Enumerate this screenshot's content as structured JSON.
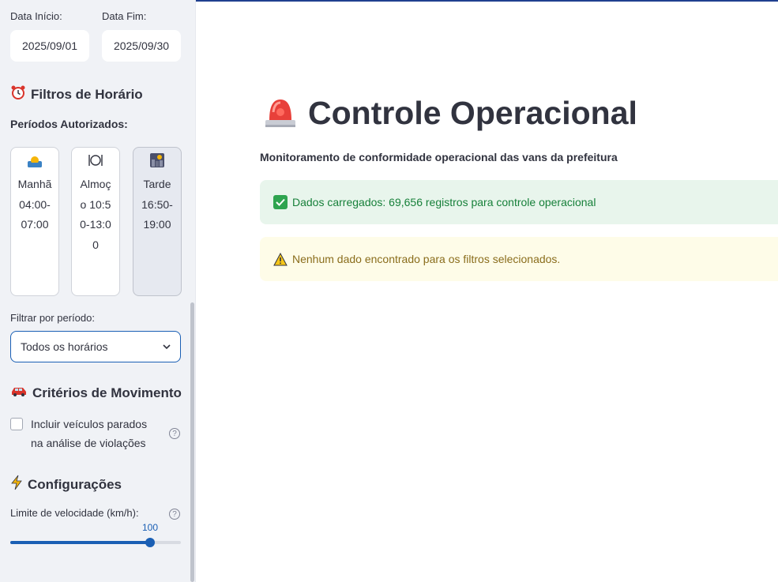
{
  "sidebar": {
    "date_start": {
      "label": "Data Início:",
      "value": "2025/09/01"
    },
    "date_end": {
      "label": "Data Fim:",
      "value": "2025/09/30"
    },
    "hours_section": {
      "title": "Filtros de Horário",
      "icon": "alarm-clock-icon"
    },
    "periods_heading": "Períodos Autorizados:",
    "periods": [
      {
        "icon": "sunrise-icon",
        "text": "Manhã 04:00-07:00",
        "active": false
      },
      {
        "icon": "plate-cutlery-icon",
        "text": "Almoço 10:50-13:00",
        "active": false
      },
      {
        "icon": "cityscape-dusk-icon",
        "text": "Tarde 16:50-19:00",
        "active": true
      }
    ],
    "filter": {
      "label": "Filtrar por período:",
      "selected": "Todos os horários"
    },
    "movement_section": {
      "title": "Critérios de Movimento",
      "icon": "car-icon"
    },
    "include_stopped": {
      "label": "Incluir veículos parados na análise de violações",
      "checked": false
    },
    "config_section": {
      "title": "Configurações",
      "icon": "lightning-icon"
    },
    "speed_limit": {
      "label": "Limite de velocidade (km/h):",
      "value": "100",
      "fraction": 0.82
    }
  },
  "main": {
    "title": "Controle Operacional",
    "title_icon": "siren-icon",
    "subtitle": "Monitoramento de conformidade operacional das vans da prefeitura",
    "success_message": "Dados carregados: 69,656 registros para controle operacional",
    "warning_message": "Nenhum dado encontrado para os filtros selecionados."
  },
  "colors": {
    "accent": "#1a5fb4",
    "success_bg": "#e8f5ec",
    "warning_bg": "#fefce8",
    "sidebar_bg": "#f0f2f6"
  }
}
